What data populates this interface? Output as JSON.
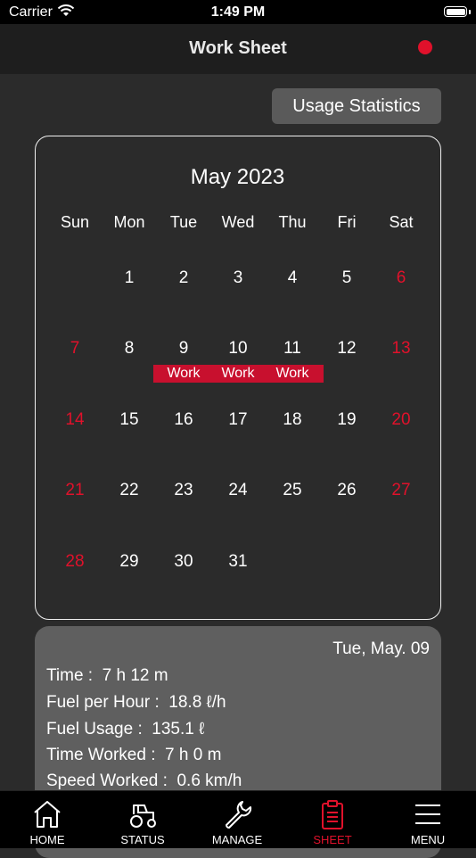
{
  "status": {
    "carrier": "Carrier",
    "time": "1:49 PM"
  },
  "header": {
    "title": "Work Sheet"
  },
  "usage_button": "Usage Statistics",
  "calendar": {
    "month": "May 2023",
    "weekdays": [
      "Sun",
      "Mon",
      "Tue",
      "Wed",
      "Thu",
      "Fri",
      "Sat"
    ],
    "days": [
      "1",
      "2",
      "3",
      "4",
      "5",
      "6",
      "7",
      "8",
      "9",
      "10",
      "11",
      "12",
      "13",
      "14",
      "15",
      "16",
      "17",
      "18",
      "19",
      "20",
      "21",
      "22",
      "23",
      "24",
      "25",
      "26",
      "27",
      "28",
      "29",
      "30",
      "31"
    ],
    "work_label": "Work",
    "weekend_color": "#e0112b"
  },
  "details": {
    "date": "Tue, May. 09",
    "time_label": "Time :",
    "time_value": "7 h 12 m",
    "fuel_hour_label": "Fuel per Hour :",
    "fuel_hour_value": "18.8 ℓ/h",
    "fuel_usage_label": "Fuel Usage :",
    "fuel_usage_value": "135.1 ℓ",
    "time_worked_label": "Time Worked :",
    "time_worked_value": "7 h 0 m",
    "speed_label": "Speed Worked :",
    "speed_value": "0.6 km/h"
  },
  "tabs": [
    {
      "label": "HOME",
      "icon": "home-icon"
    },
    {
      "label": "STATUS",
      "icon": "tractor-icon"
    },
    {
      "label": "MANAGE",
      "icon": "wrench-icon"
    },
    {
      "label": "SHEET",
      "icon": "clipboard-icon",
      "active": true
    },
    {
      "label": "MENU",
      "icon": "menu-icon"
    }
  ],
  "accent_color": "#e0112b"
}
